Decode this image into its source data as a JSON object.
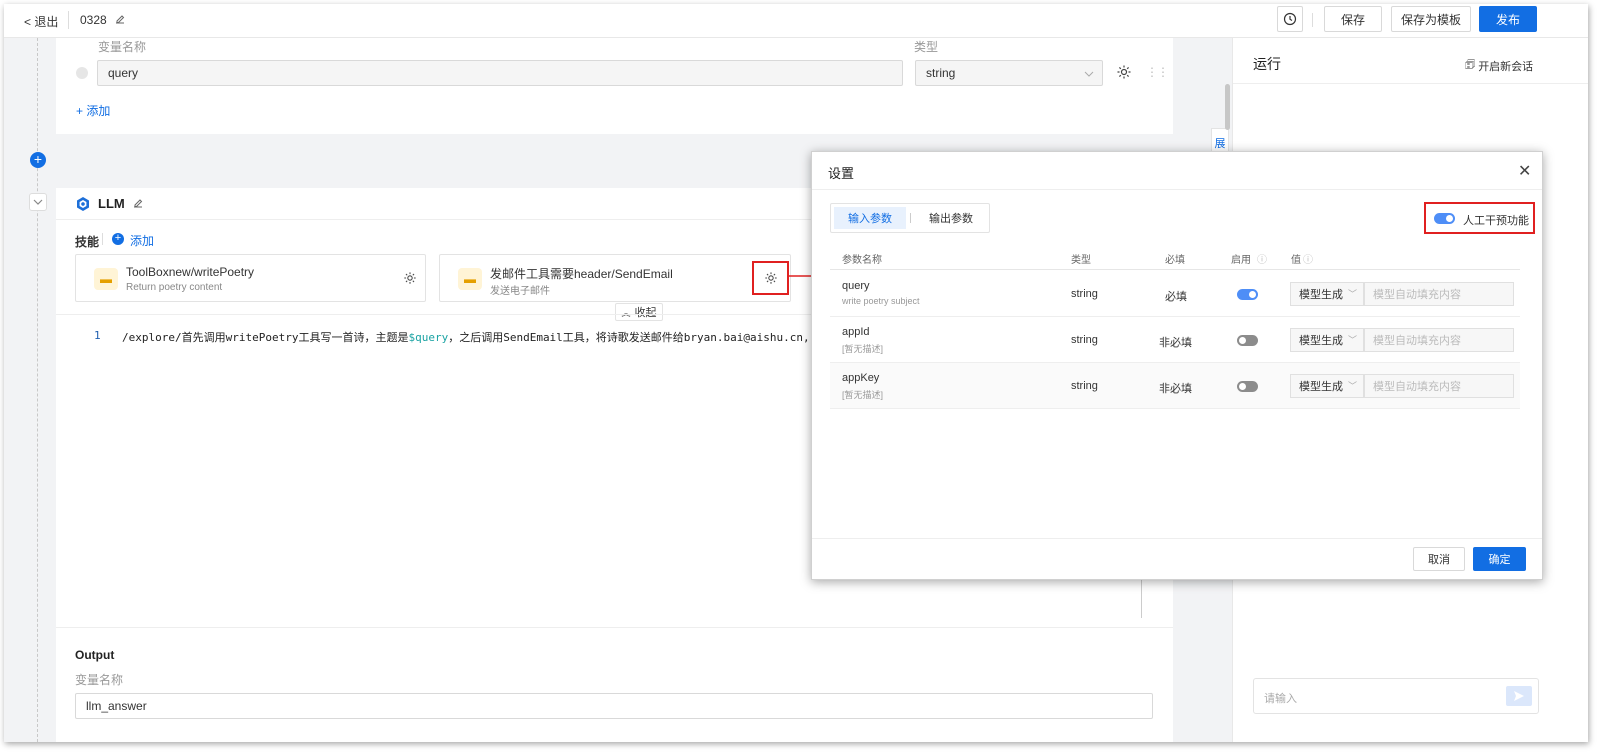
{
  "topbar": {
    "back_label": "< 退出",
    "doc_name": "0328",
    "history_icon": "history-icon",
    "save_label": "保存",
    "save_template_label": "保存为模板",
    "publish_label": "发布"
  },
  "input_card": {
    "var_name_header": "变量名称",
    "type_header": "类型",
    "var_value": "query",
    "type_value": "string",
    "add_label": "+ 添加"
  },
  "llm_card": {
    "title": "LLM",
    "skills_label": "技能",
    "add_skill_label": "添加",
    "skills": [
      {
        "name": "ToolBoxnew/writePoetry",
        "desc": "Return poetry content"
      },
      {
        "name": "发邮件工具需要header/SendEmail",
        "desc": "发送电子邮件"
      }
    ],
    "collapse_label": "收起",
    "prompt_line_number": "1",
    "prompt_before": "/explore/首先调用writePoetry工具写一首诗，主题是",
    "prompt_var": "$query",
    "prompt_after": "，之后调用SendEmail工具，将诗歌发送邮件给bryan.bai@aishu.cn,",
    "output_title": "Output",
    "output_var_label": "变量名称",
    "output_var_value": "llm_answer",
    "side_tab": "展"
  },
  "run_panel": {
    "title": "运行",
    "new_session_label": "开启新会话",
    "input_placeholder": "请输入"
  },
  "modal": {
    "title": "设置",
    "tab_input": "输入参数",
    "tab_output": "输出参数",
    "manual_intervene_label": "人工干预功能",
    "columns": {
      "name": "参数名称",
      "type": "类型",
      "required": "必填",
      "enabled": "启用",
      "value": "值"
    },
    "rows": [
      {
        "name": "query",
        "desc": "write poetry subject",
        "type": "string",
        "required": "必填",
        "enabled": true,
        "mode": "模型生成",
        "placeholder": "模型自动填充内容"
      },
      {
        "name": "appId",
        "desc": "[暂无描述]",
        "type": "string",
        "required": "非必填",
        "enabled": false,
        "mode": "模型生成",
        "placeholder": "模型自动填充内容"
      },
      {
        "name": "appKey",
        "desc": "[暂无描述]",
        "type": "string",
        "required": "非必填",
        "enabled": false,
        "mode": "模型生成",
        "placeholder": "模型自动填充内容"
      }
    ],
    "cancel_label": "取消",
    "confirm_label": "确定"
  },
  "colors": {
    "accent": "#126ee3",
    "highlight": "#e02020",
    "toggle_on": "#4e8ef7"
  }
}
